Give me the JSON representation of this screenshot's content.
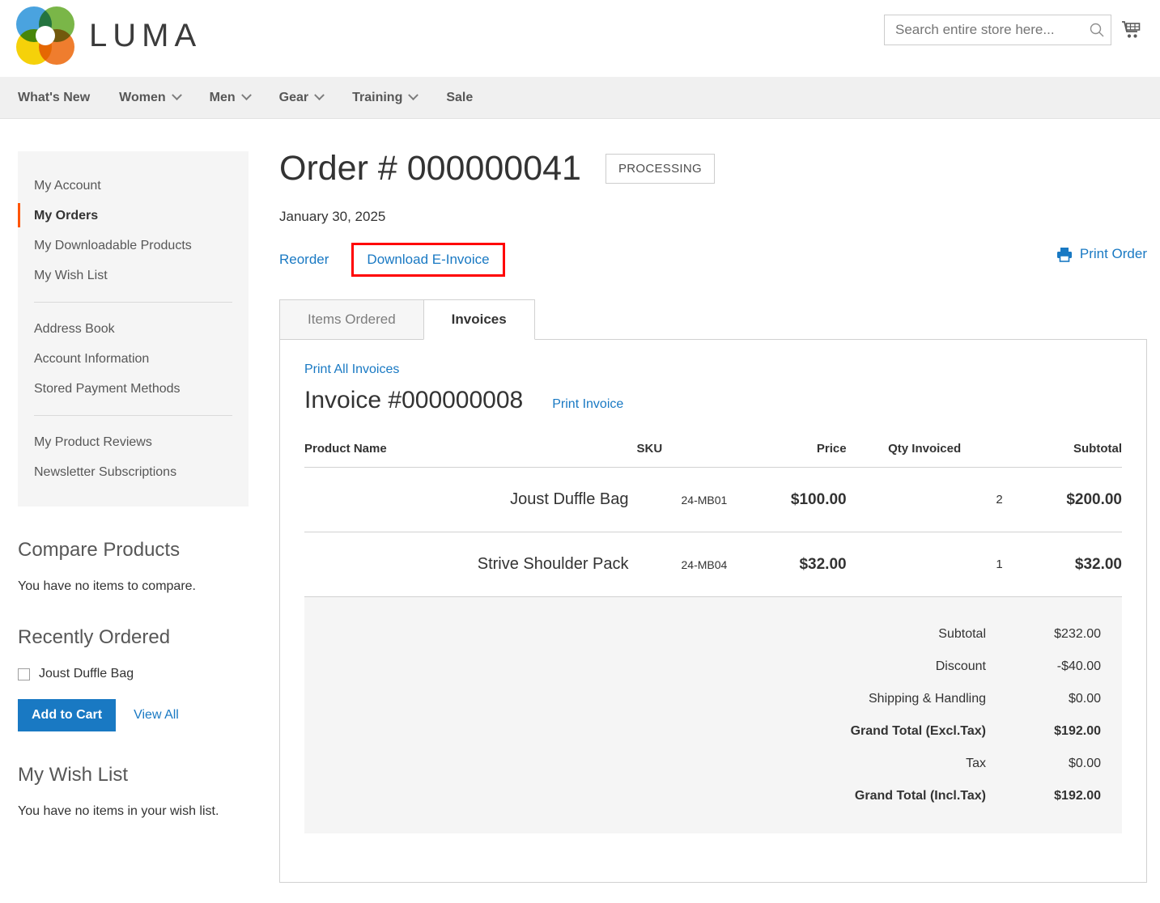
{
  "header": {
    "brand": "LUMA",
    "search": {
      "placeholder": "Search entire store here...",
      "value": "",
      "icon": "search-icon"
    },
    "cart_icon": "shopping-cart-icon"
  },
  "nav": {
    "items": [
      {
        "label": "What's New",
        "has_caret": false
      },
      {
        "label": "Women",
        "has_caret": true
      },
      {
        "label": "Men",
        "has_caret": true
      },
      {
        "label": "Gear",
        "has_caret": true
      },
      {
        "label": "Training",
        "has_caret": true
      },
      {
        "label": "Sale",
        "has_caret": false
      }
    ]
  },
  "sidebar": {
    "account_nav": {
      "group1": [
        {
          "label": "My Account",
          "active": false
        },
        {
          "label": "My Orders",
          "active": true
        },
        {
          "label": "My Downloadable Products",
          "active": false
        },
        {
          "label": "My Wish List",
          "active": false
        }
      ],
      "group2": [
        {
          "label": "Address Book"
        },
        {
          "label": "Account Information"
        },
        {
          "label": "Stored Payment Methods"
        }
      ],
      "group3": [
        {
          "label": "My Product Reviews"
        },
        {
          "label": "Newsletter Subscriptions"
        }
      ]
    },
    "compare": {
      "title": "Compare Products",
      "empty_text": "You have no items to compare."
    },
    "recently_ordered": {
      "title": "Recently Ordered",
      "items": [
        {
          "label": "Joust Duffle Bag",
          "checked": false
        }
      ],
      "add_to_cart_label": "Add to Cart",
      "view_all_label": "View All"
    },
    "wishlist": {
      "title": "My Wish List",
      "empty_text": "You have no items in your wish list."
    }
  },
  "order": {
    "title": "Order # 000000041",
    "status": "PROCESSING",
    "date": "January 30, 2025",
    "actions": {
      "reorder": "Reorder",
      "download_einvoice": "Download E-Invoice",
      "print_order": "Print Order",
      "highlight_color": "#ff0000"
    },
    "tabs": [
      {
        "label": "Items Ordered",
        "active": false
      },
      {
        "label": "Invoices",
        "active": true
      }
    ]
  },
  "invoices": {
    "print_all_label": "Print All Invoices",
    "invoice_number": "Invoice #000000008",
    "print_invoice_label": "Print Invoice",
    "columns": [
      "Product Name",
      "SKU",
      "Price",
      "Qty Invoiced",
      "Subtotal"
    ],
    "rows": [
      {
        "name": "Joust Duffle Bag",
        "sku": "24-MB01",
        "price": "$100.00",
        "qty": "2",
        "subtotal": "$200.00"
      },
      {
        "name": "Strive Shoulder Pack",
        "sku": "24-MB04",
        "price": "$32.00",
        "qty": "1",
        "subtotal": "$32.00"
      }
    ],
    "totals": [
      {
        "label": "Subtotal",
        "value": "$232.00",
        "bold": false
      },
      {
        "label": "Discount",
        "value": "-$40.00",
        "bold": false
      },
      {
        "label": "Shipping & Handling",
        "value": "$0.00",
        "bold": false
      },
      {
        "label": "Grand Total (Excl.Tax)",
        "value": "$192.00",
        "bold": true
      },
      {
        "label": "Tax",
        "value": "$0.00",
        "bold": false
      },
      {
        "label": "Grand Total (Incl.Tax)",
        "value": "$192.00",
        "bold": true
      }
    ]
  },
  "colors": {
    "link": "#1979c3",
    "accent": "#ff5501",
    "highlight": "#ff0000",
    "panel_bg": "#f5f5f5"
  }
}
